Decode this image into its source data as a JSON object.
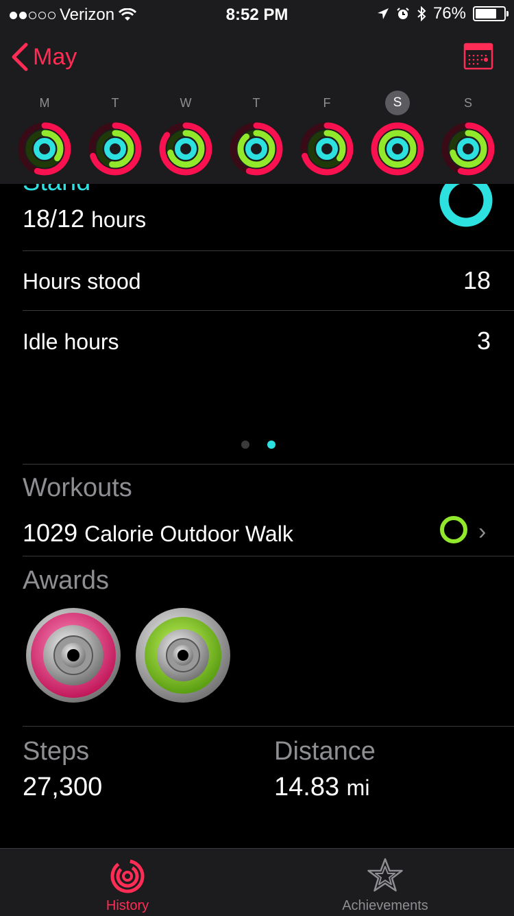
{
  "status": {
    "carrier": "Verizon",
    "time": "8:52 PM",
    "battery": "76%",
    "battery_level": 0.76
  },
  "nav": {
    "back_label": "May"
  },
  "week": [
    {
      "letter": "M",
      "selected": false
    },
    {
      "letter": "T",
      "selected": false
    },
    {
      "letter": "W",
      "selected": false
    },
    {
      "letter": "T",
      "selected": false
    },
    {
      "letter": "F",
      "selected": false
    },
    {
      "letter": "S",
      "selected": true
    },
    {
      "letter": "S",
      "selected": false
    }
  ],
  "stand": {
    "title": "Stand",
    "value": "18/12",
    "unit": "hours"
  },
  "rows": [
    {
      "label": "Hours stood",
      "value": "18"
    },
    {
      "label": "Idle hours",
      "value": "3"
    }
  ],
  "workouts": {
    "heading": "Workouts",
    "calories": "1029",
    "description": "Calorie Outdoor Walk"
  },
  "awards": {
    "heading": "Awards"
  },
  "stats": {
    "steps_label": "Steps",
    "steps_value": "27,300",
    "distance_label": "Distance",
    "distance_value": "14.83",
    "distance_unit": "mi"
  },
  "tabs": {
    "history": "History",
    "achievements": "Achievements"
  },
  "colors": {
    "accent": "#ff2d55",
    "move": "#fa114f",
    "exercise": "#92e82a",
    "stand": "#2de1e1"
  }
}
